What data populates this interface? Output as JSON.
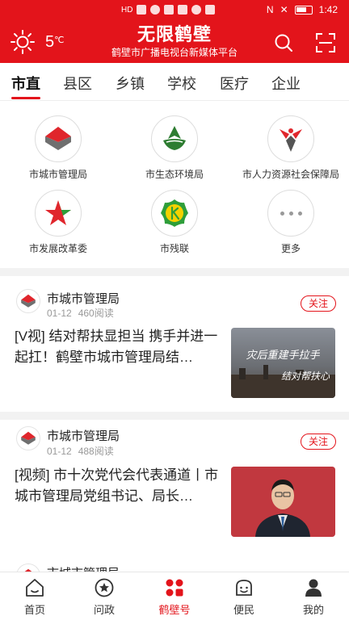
{
  "status_bar": {
    "time": "1:42",
    "left_text": "HD",
    "battery_label": "battery"
  },
  "header": {
    "temperature": "5",
    "temp_unit": "℃",
    "title": "无限鹤壁",
    "subtitle": "鹤壁市广播电视台新媒体平台",
    "weather_icon": "sun-icon",
    "search_icon": "search-icon",
    "scan_icon": "scan-icon",
    "brand_color": "#e3141b"
  },
  "tabs": [
    {
      "label": "市直",
      "active": true
    },
    {
      "label": "县区",
      "active": false
    },
    {
      "label": "乡镇",
      "active": false
    },
    {
      "label": "学校",
      "active": false
    },
    {
      "label": "医疗",
      "active": false
    },
    {
      "label": "企业",
      "active": false
    }
  ],
  "grid": [
    {
      "label": "市城市管理局",
      "icon": "urban-management-logo"
    },
    {
      "label": "市生态环境局",
      "icon": "ecology-environment-logo"
    },
    {
      "label": "市人力资源社会保障局",
      "icon": "human-resources-logo"
    },
    {
      "label": "市发展改革委",
      "icon": "development-reform-logo"
    },
    {
      "label": "市残联",
      "icon": "disabled-federation-logo"
    },
    {
      "label": "更多",
      "icon": "more-icon"
    }
  ],
  "feed": [
    {
      "account": "市城市管理局",
      "date": "01-12",
      "reads": "460阅读",
      "follow": "关注",
      "title": "[V视] 结对帮扶显担当 携手并进一起扛！鹤壁市城市管理局结…",
      "thumb_text_1": "灾后重建手拉手",
      "thumb_text_2": "结对帮扶心"
    },
    {
      "account": "市城市管理局",
      "date": "01-12",
      "reads": "488阅读",
      "follow": "关注",
      "title": "[视频] 市十次党代会代表通道丨市城市管理局党组书记、局长…"
    },
    {
      "account": "市城市管理局"
    }
  ],
  "bottom_nav": [
    {
      "label": "首页",
      "icon": "home-icon",
      "active": false
    },
    {
      "label": "问政",
      "icon": "star-badge-icon",
      "active": false
    },
    {
      "label": "鹤壁号",
      "icon": "grid-app-icon",
      "active": true
    },
    {
      "label": "便民",
      "icon": "smile-house-icon",
      "active": false
    },
    {
      "label": "我的",
      "icon": "user-icon",
      "active": false
    }
  ]
}
